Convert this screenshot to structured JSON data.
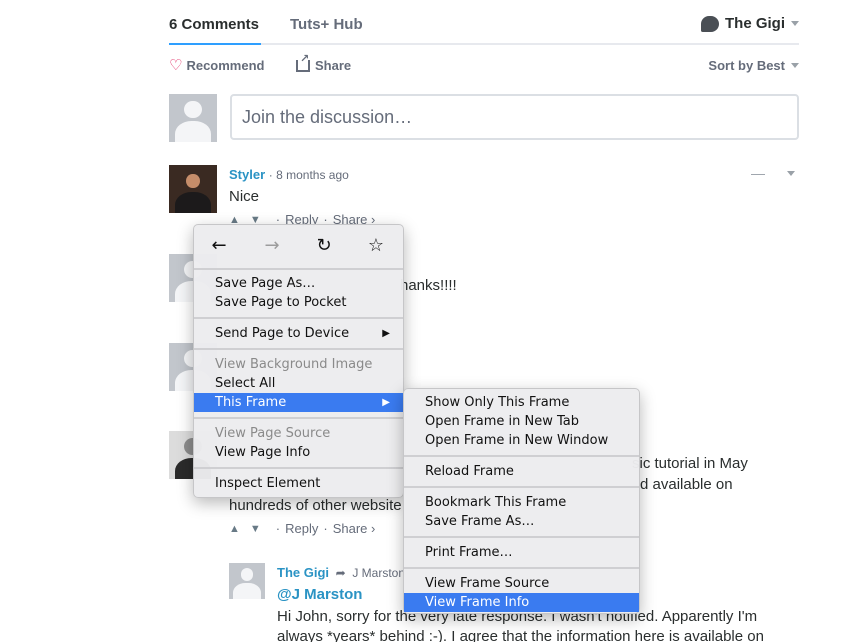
{
  "tabs": {
    "comments": "6 Comments",
    "hub": "Tuts+ Hub",
    "user": "The Gigi"
  },
  "actions": {
    "recommend": "Recommend",
    "share": "Share",
    "sort": "Sort by Best"
  },
  "join": {
    "placeholder": "Join the discussion…"
  },
  "colors": {
    "accent": "#2e9fff",
    "link": "#2a93c4",
    "highlight": "#3a7bf0"
  },
  "comments": [
    {
      "author": "Styler",
      "meta": "· 8 months ago",
      "text": "Nice",
      "reply": "Reply",
      "share": "Share ›"
    },
    {
      "text": "hanks!!!!"
    },
    {
      "text1": "sic tutorial in May",
      "text2": "d available on",
      "text3": "hundreds of other website",
      "reply": "Reply",
      "share": "Share ›"
    },
    {
      "author": "The Gigi",
      "reply_to": "J Marston",
      "mention": "@J Marston",
      "line1": "Hi John, sorry for the very late response. I wasn't notified. Apparently I'm",
      "line2": "always *years* behind :-). I agree that the information here is available on"
    }
  ],
  "context_menu": {
    "nav": [
      "back-icon",
      "forward-icon",
      "reload-icon",
      "bookmark-star-icon"
    ],
    "items": {
      "save_page_as": "Save Page As…",
      "save_to_pocket": "Save Page to Pocket",
      "send_to_device": "Send Page to Device",
      "view_bg_image": "View Background Image",
      "select_all": "Select All",
      "this_frame": "This Frame",
      "view_page_source": "View Page Source",
      "view_page_info": "View Page Info",
      "inspect": "Inspect Element"
    },
    "submenu": {
      "show_only": "Show Only This Frame",
      "open_tab": "Open Frame in New Tab",
      "open_window": "Open Frame in New Window",
      "reload": "Reload Frame",
      "bookmark": "Bookmark This Frame",
      "save_as": "Save Frame As…",
      "print": "Print Frame…",
      "source": "View Frame Source",
      "info": "View Frame Info"
    }
  }
}
